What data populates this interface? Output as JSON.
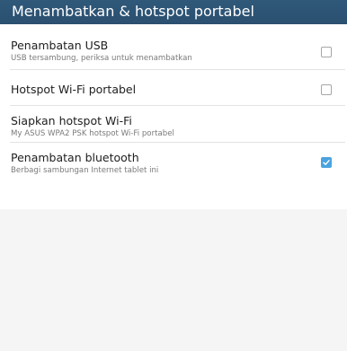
{
  "header": {
    "title": "Menambatkan & hotspot portabel"
  },
  "items": [
    {
      "title": "Penambatan USB",
      "summary": "USB tersambung, periksa untuk menambatkan",
      "checked": false
    },
    {
      "title": "Hotspot Wi-Fi portabel",
      "summary": "",
      "checked": false
    },
    {
      "title": "Siapkan hotspot Wi-Fi",
      "summary": "My ASUS WPA2 PSK hotspot Wi-Fi portabel"
    },
    {
      "title": "Penambatan bluetooth",
      "summary": "Berbagi sambungan Internet tablet ini",
      "checked": true
    }
  ],
  "colors": {
    "app_bar": "#2d5474",
    "accent": "#4aa3df",
    "background": "#f5f5f5"
  }
}
